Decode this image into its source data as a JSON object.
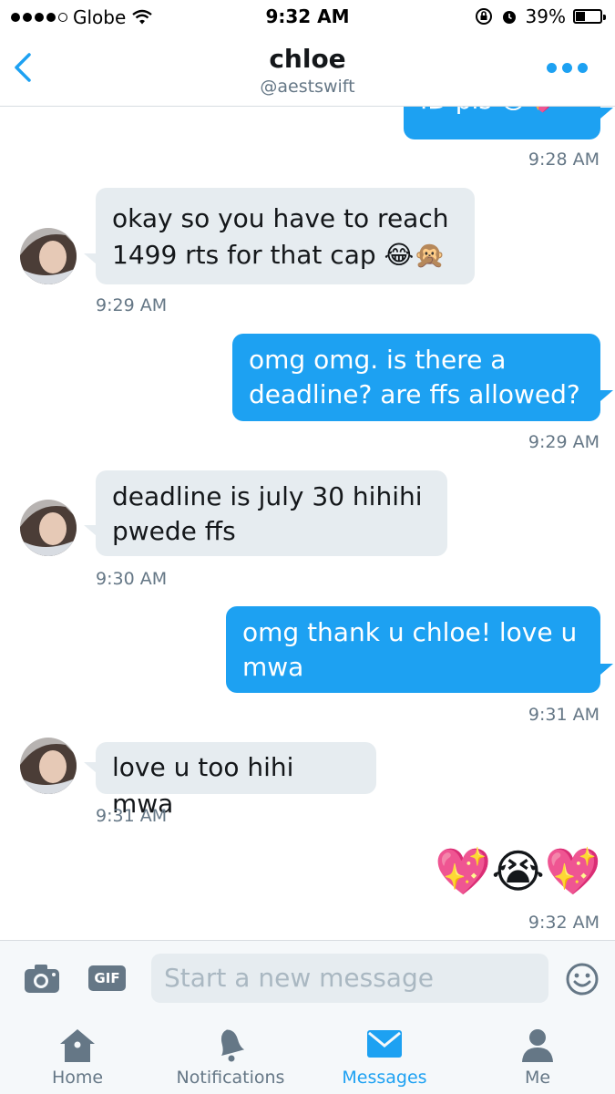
{
  "status_bar": {
    "carrier": "Globe",
    "time": "9:32 AM",
    "battery": "39%",
    "battery_level": 0.39
  },
  "header": {
    "name": "chloe",
    "handle": "@aestswift"
  },
  "messages": [
    {
      "direction": "out",
      "text": "ID pls 😳💖",
      "time": "9:28 AM"
    },
    {
      "direction": "in",
      "text": "okay so you have to reach 1499 rts for that cap 😂🙊",
      "time": "9:29 AM"
    },
    {
      "direction": "out",
      "text": "omg omg. is there a deadline? are ffs allowed?",
      "time": "9:29 AM"
    },
    {
      "direction": "in",
      "text": "deadline is july 30 hihihi pwede ffs",
      "time": "9:30 AM"
    },
    {
      "direction": "out",
      "text": "omg thank u chloe! love u mwa",
      "time": "9:31 AM"
    },
    {
      "direction": "in",
      "text": "love u too hihi mwa",
      "time": "9:31 AM"
    },
    {
      "direction": "out",
      "text": "💖😭💖",
      "time": "9:32 AM"
    }
  ],
  "composer": {
    "placeholder": "Start a new message",
    "gif_label": "GIF"
  },
  "tabs": [
    {
      "label": "Home",
      "icon": "home-icon"
    },
    {
      "label": "Notifications",
      "icon": "bell-icon"
    },
    {
      "label": "Messages",
      "icon": "envelope-icon",
      "active": true
    },
    {
      "label": "Me",
      "icon": "person-icon"
    }
  ],
  "colors": {
    "accent": "#1da1f2",
    "incoming_bubble": "#e6ecf0",
    "secondary_text": "#657786"
  }
}
